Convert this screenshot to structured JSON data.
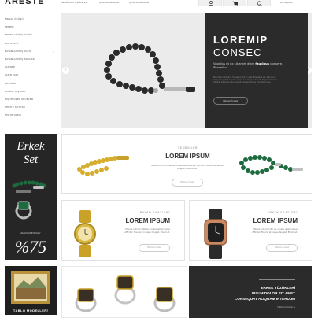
{
  "header": {
    "logo": "ARESTE",
    "nav": [
      "İNDİRİMLİ ÜRÜNLER",
      "ÇOK SATANLAR",
      "ÇOK SATANLAR"
    ],
    "icons": [
      "user-icon",
      "cart-icon",
      "search-icon"
    ],
    "language": "Dil Seçiniz"
  },
  "sidebar": {
    "items": [
      {
        "label": "FIRSAT ÜRÜNÜ",
        "chevron": ""
      },
      {
        "label": "TESBİH",
        "chevron": "›"
      },
      {
        "label": "ERKEK GÜMÜŞ YÜZÜK",
        "chevron": ""
      },
      {
        "label": "BEL ASKISI",
        "chevron": ""
      },
      {
        "label": "BAYAN GÜMÜŞ KOLYE",
        "chevron": "›"
      },
      {
        "label": "BAYAN GÜMÜŞ TAKILAR",
        "chevron": ""
      },
      {
        "label": "ALTINKE",
        "chevron": ""
      },
      {
        "label": "ALTIN TAKI",
        "chevron": ""
      },
      {
        "label": "BİLEKLİK",
        "chevron": ""
      },
      {
        "label": "DOĞAL TAŞ TAKI",
        "chevron": ""
      },
      {
        "label": "KİŞİYE ÖZEL ÜRÜNLER",
        "chevron": ""
      },
      {
        "label": "HEDİYE KUTUSU",
        "chevron": ""
      },
      {
        "label": "KİŞİYE YAZILI",
        "chevron": ""
      }
    ]
  },
  "hero": {
    "title": "LOREMIP",
    "subtitle": "CONSEC",
    "text_pre": "Vasellus ut ex sit amet diam ",
    "text_bold": "faucibus",
    "text_post": " posuere. Phasellus",
    "small": "Mauris in nisl tellus. Praesent sed ex erat. Phasellus vel, Mauris et neque feugiat fi, liquam ornare sed lacus euismod. Aliquam lobortis, fringilla ipsum portae suscipit posuere. Fusce fringilla ornare.",
    "button": "Hemen İncele",
    "prev": "‹",
    "next": "›"
  },
  "promo_erkek": {
    "title1": "Erkek",
    "title2": "Set",
    "sub": "Indirimli Erkekler",
    "percent": "%75"
  },
  "tesbihler": {
    "small": "TESBİHLER",
    "big": "LOREM IPSUM",
    "desc": "Mauris rutrum nibh eu ornare ullamcorper efficitur. Mauris et neque feugiat fi tesbih et.",
    "button": "Hemen İncele"
  },
  "bayan_saatleri": {
    "small": "BAYAN SAATLERİ",
    "big": "LOREM IPSUM",
    "desc": "Mauris rutrum nibh eu ornare ullamcorper efficitur. Mauris et neque feugiat. Etiam et.",
    "button": "Hemen İncele"
  },
  "erkek_saatleri": {
    "small": "ERKEK SAATLERİ",
    "big": "LOREM IPSUM",
    "desc": "Mauris rutrum nibh eu ornare ullamcorper efficitur. Mauris et neque feugiat. Etiam et.",
    "button": "Hemen İncele"
  },
  "tablo": {
    "label": "TABLO MODELLERİ"
  },
  "erkek_yuzukler": {
    "line1": "ERKEK YÜZÜKLERİ",
    "line2": "IPSUM DOLOR SIT AMET",
    "line3": "CONSEQUAT ALIQUAM INTERDUM",
    "link": "Hemen İncele →"
  },
  "colors": {
    "dark_panel": "#2b2b2b",
    "light_bg": "#ebebeb",
    "accent_gold": "#c9a227",
    "accent_green": "#1e6b3f"
  }
}
